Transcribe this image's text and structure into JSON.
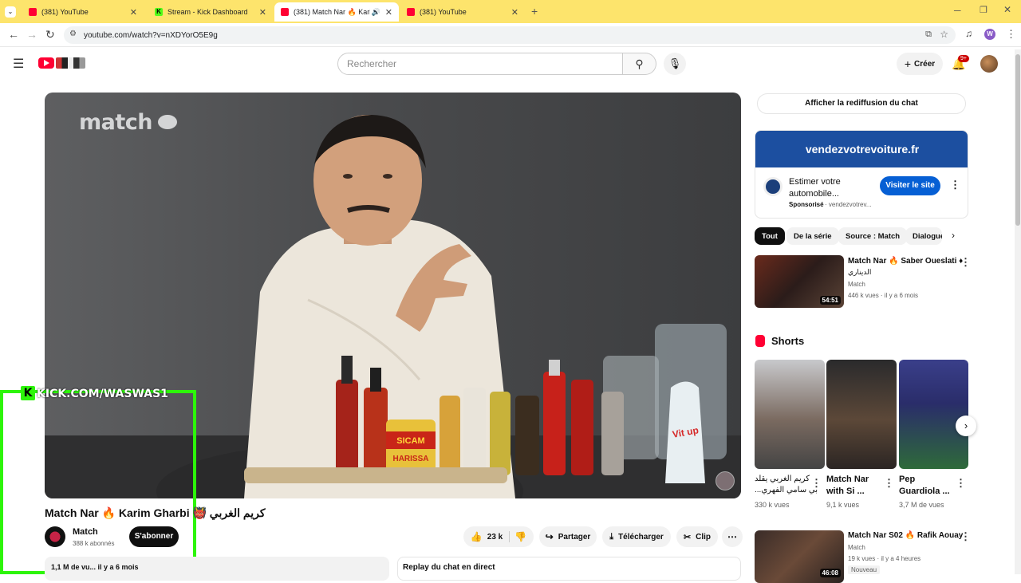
{
  "browser": {
    "tabs": [
      {
        "label": "(381) YouTube",
        "fav": "yt",
        "close": "✕"
      },
      {
        "label": "Stream - Kick Dashboard",
        "fav": "kick",
        "close": "✕"
      },
      {
        "label": "(381) Match Nar 🔥 Karim G",
        "fav": "yt",
        "close": "✕"
      },
      {
        "label": "(381) YouTube",
        "fav": "yt",
        "close": "✕"
      }
    ],
    "new_tab": "+",
    "url": "youtube.com/watch?v=nXDYorO5E9g",
    "profile_initial": "W"
  },
  "header": {
    "search_placeholder": "Rechercher",
    "create_label": "Créer",
    "notif_count": "9+"
  },
  "video": {
    "brand": "match",
    "title": "Match Nar 🔥 Karim Gharbi 👹 كريم الغربي",
    "channel_name": "Match",
    "subscribers": "388 k abonnés",
    "subscribe_label": "S'abonner",
    "likes": "23 k",
    "share_label": "Partager",
    "download_label": "Télécharger",
    "clip_label": "Clip",
    "views": "1,1 M de vu... il y a 6 mois",
    "chat_replay": "Replay du chat en direct",
    "bottles": [
      "HARISSA",
      "SICAM",
      "Vit up"
    ]
  },
  "overlay": {
    "kick_text": "KICK.COM/WASWAS1",
    "kick_glyph": "K"
  },
  "sidebar": {
    "chat_button": "Afficher la rediffusion du chat",
    "ad": {
      "banner": "vendezvotrevoiture.fr",
      "title_line1": "Estimer votre",
      "title_line2": "automobile...",
      "sponsored": "Sponsorisé",
      "domain": "· vendezvotrev...",
      "cta": "Visiter le site"
    },
    "chips": [
      "Tout",
      "De la série",
      "Source : Match",
      "Dialogue"
    ],
    "videos": [
      {
        "title": "Match Nar 🔥 Saber Oueslati ♦",
        "subtitle": "الديناري",
        "channel": "Match",
        "meta": "446 k vues · il y a 6 mois",
        "duration": "54:51"
      },
      {
        "title": "Match Nar S02 🔥 Rafik Aouay",
        "channel": "Match",
        "meta": "19 k vues · il y a 4 heures",
        "badge": "Nouveau",
        "duration": "46:08"
      }
    ],
    "shorts_title": "Shorts",
    "shorts": [
      {
        "title1": "كريم الغربي يقلد",
        "title2": "...بي سامي الفهري",
        "views": "330 k vues"
      },
      {
        "title1": "Match Nar",
        "title2": "with Si ...",
        "views": "9,1 k vues"
      },
      {
        "title1": "Pep",
        "title2": "Guardiola ...",
        "views": "3,7 M de vues"
      }
    ]
  },
  "colors": {
    "brand_red": "#ff0033",
    "kick_green": "#2df50a",
    "tab_bar": "#fde46c",
    "subscribe_bg": "#0f0f0f",
    "ad_cta": "#065fd4"
  }
}
